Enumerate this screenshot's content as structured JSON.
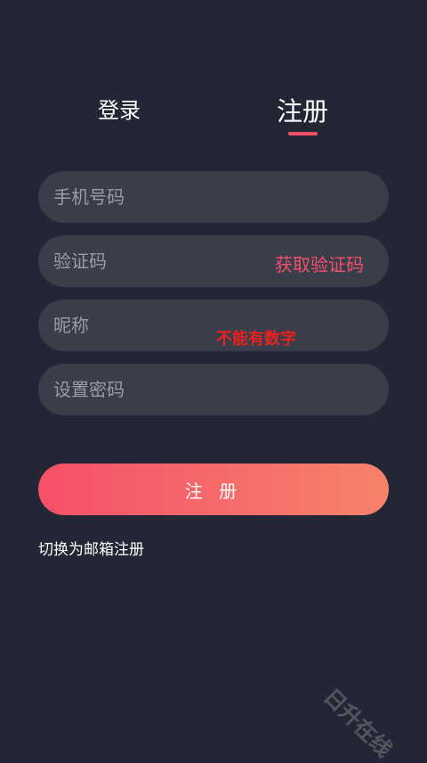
{
  "tabs": {
    "login_label": "登录",
    "register_label": "注册",
    "active": "register",
    "accent_color": "#f4506a"
  },
  "form": {
    "phone": {
      "placeholder": "手机号码",
      "value": ""
    },
    "code": {
      "placeholder": "验证码",
      "value": "",
      "get_code_label": "获取验证码"
    },
    "nickname": {
      "placeholder": "昵称",
      "value": "",
      "hint": "不能有数字"
    },
    "password": {
      "placeholder": "设置密码",
      "value": ""
    }
  },
  "submit_label": "注 册",
  "switch_link": "切换为邮箱注册",
  "watermark": "日升在线",
  "colors": {
    "background": "#232634",
    "field_background": "#3a3d4a",
    "button_gradient_start": "#f5506a",
    "button_gradient_end": "#f6836b",
    "hint_color": "#e8221e"
  }
}
